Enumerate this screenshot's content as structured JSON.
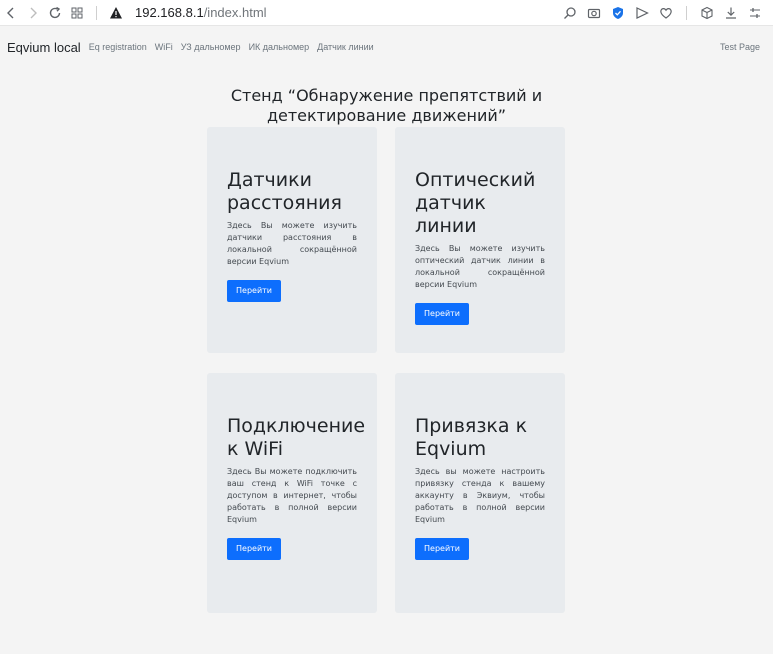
{
  "browser": {
    "url_host": "192.168.8.1",
    "url_path": "/index.html"
  },
  "navbar": {
    "brand": "Eqvium local",
    "links": [
      "Eq registration",
      "WiFi",
      "УЗ дальномер",
      "ИК дальномер",
      "Датчик линии"
    ],
    "right_link": "Test Page"
  },
  "main": {
    "title": "Стенд “Обнаружение препятствий и детектирование движений”",
    "cards": [
      {
        "title": "Датчики расстояния",
        "text": "Здесь Вы можете изучить датчики расстояния в локальной сокращённой версии Eqvium",
        "button": "Перейти"
      },
      {
        "title": "Оптический датчик линии",
        "text": "Здесь Вы можете изучить оптический датчик линии в локальной сокращённой версии Eqvium",
        "button": "Перейти"
      },
      {
        "title": "Подключение к WiFi",
        "text": "Здесь Вы можете подключить ваш стенд к WiFi точке с доступом в интернет, чтобы работать в полной версии Eqvium",
        "button": "Перейти"
      },
      {
        "title": "Привязка к Eqvium",
        "text": "Здесь вы можете настроить привязку стенда к вашему аккаунту в Эквиум, чтобы работать в полной версии Eqvium",
        "button": "Перейти"
      }
    ]
  },
  "colors": {
    "accent": "#0d6efd",
    "card_bg": "#e8ebee",
    "page_bg": "#f4f4f4"
  }
}
